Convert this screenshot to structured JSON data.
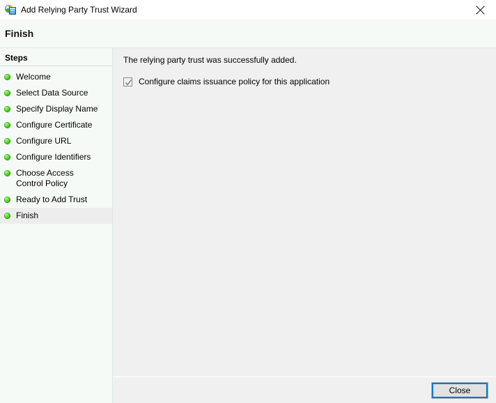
{
  "window": {
    "title": "Add Relying Party Trust Wizard",
    "icon": "relying-party-trust-icon",
    "close_icon": "close-icon"
  },
  "page": {
    "title": "Finish"
  },
  "sidebar": {
    "heading": "Steps",
    "bullet_color": "#2db100",
    "items": [
      {
        "label": "Welcome",
        "state": "complete"
      },
      {
        "label": "Select Data Source",
        "state": "complete"
      },
      {
        "label": "Specify Display Name",
        "state": "complete"
      },
      {
        "label": "Configure Certificate",
        "state": "complete"
      },
      {
        "label": "Configure URL",
        "state": "complete"
      },
      {
        "label": "Configure Identifiers",
        "state": "complete"
      },
      {
        "label": "Choose Access Control Policy",
        "state": "complete"
      },
      {
        "label": "Ready to Add Trust",
        "state": "complete"
      },
      {
        "label": "Finish",
        "state": "current"
      }
    ]
  },
  "main": {
    "message": "The relying party trust was successfully added.",
    "checkbox": {
      "label": "Configure claims issuance policy for this application",
      "checked": true,
      "check_color": "#707070"
    }
  },
  "footer": {
    "close_label": "Close",
    "focus_color": "#0078d7"
  }
}
